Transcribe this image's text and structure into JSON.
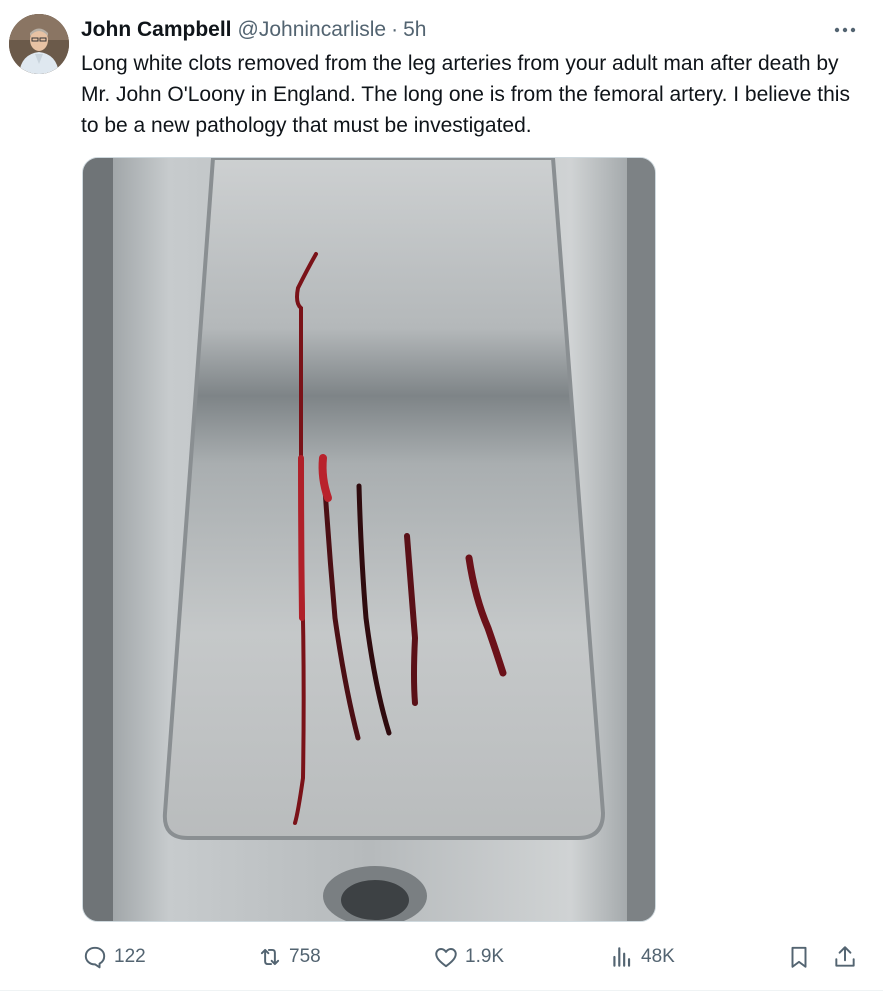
{
  "tweet": {
    "author_name": "John Campbell",
    "author_handle": "@Johnincarlisle",
    "separator": "·",
    "timestamp": "5h",
    "text": "Long white clots removed from the leg arteries from your adult man after death by Mr. John O'Loony in England. The long one is from the femoral artery. I believe this to be a new pathology that must be investigated."
  },
  "icons": {
    "more": "more-horizontal-icon",
    "reply": "reply-icon",
    "retweet": "retweet-icon",
    "like": "heart-icon",
    "views": "views-icon",
    "bookmark": "bookmark-icon",
    "share": "share-icon"
  },
  "actions": {
    "replies": "122",
    "retweets": "758",
    "likes": "1.9K",
    "views": "48K"
  },
  "colors": {
    "text_primary": "#0f1419",
    "text_secondary": "#536471",
    "border": "#cfd9de"
  }
}
